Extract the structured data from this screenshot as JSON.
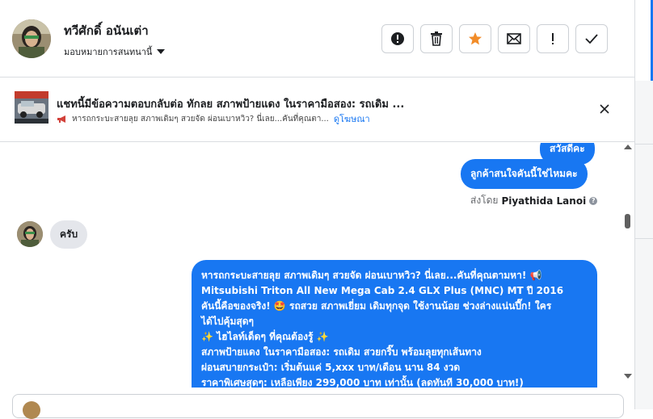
{
  "header": {
    "user_name": "ทวีศักดิ์ อนันเต่า",
    "assign_label": "มอบหมายการสนทนานี้",
    "actions": [
      {
        "icon": "exclamation-circle-icon",
        "label": ""
      },
      {
        "icon": "trash-icon",
        "label": ""
      },
      {
        "icon": "star-icon",
        "label": "",
        "color": "#f28c28"
      },
      {
        "icon": "envelope-icon",
        "label": ""
      },
      {
        "icon": "exclamation-icon",
        "label": ""
      },
      {
        "icon": "check-icon",
        "label": ""
      }
    ]
  },
  "banner": {
    "title": "แชทนี้มีข้อความตอบกลับต่อ ทักลย สภาพป้ายแดง ในราคามือสอง: รถเดิม ...",
    "subtitle": "หารถกระบะสายลุย สภาพเดิมๆ สวยจัด ผ่อนเบาหวิว? นี่เลย...คันที่คุณตา...",
    "ad_link": "ดูโฆษณา"
  },
  "chat": {
    "messages_out_top": [
      {
        "text": "สวัสดีคะ"
      },
      {
        "text": "ลูกค้าสนใจคันนี้ใช่ไหมคะ"
      }
    ],
    "sent_by_prefix": "ส่งโดย",
    "sent_by_name": "Piyathida Lanoi",
    "message_in": "ครับ",
    "long_message_lines": [
      "หารถกระบะสายลุย สภาพเดิมๆ สวยจัด ผ่อนเบาหวิว? นี่เลย...คันที่คุณตามหา! 📢",
      "Mitsubishi Triton All New Mega Cab 2.4 GLX Plus (MNC) MT ปี 2016",
      "คันนี้คือของจริง! 🤩 รถสวย สภาพเยี่ยม เดิมทุกจุด ใช้งานน้อย ช่วงล่างแน่นปึ๊ก! ใคร",
      "ได้ไปคุ้มสุดๆ",
      "✨ ไฮไลท์เด็ดๆ ที่คุณต้องรู้ ✨",
      "สภาพป้ายแดง ในราคามือสอง: รถเดิม สวยกริ๊บ พร้อมลุยทุกเส้นทาง",
      "ผ่อนสบายกระเป๋า: เริ่มต้นแค่ 5,xxx บาท/เดือน นาน 84 งวด",
      "ราคาพิเศษสุดๆ: เหลือเพียง 299,000 บาท เท่านั้น (ลดทันที 30,000 บาท!)"
    ]
  },
  "colors": {
    "accent": "#1877f2",
    "star": "#f28c28",
    "incoming_bubble": "#e4e6eb"
  }
}
